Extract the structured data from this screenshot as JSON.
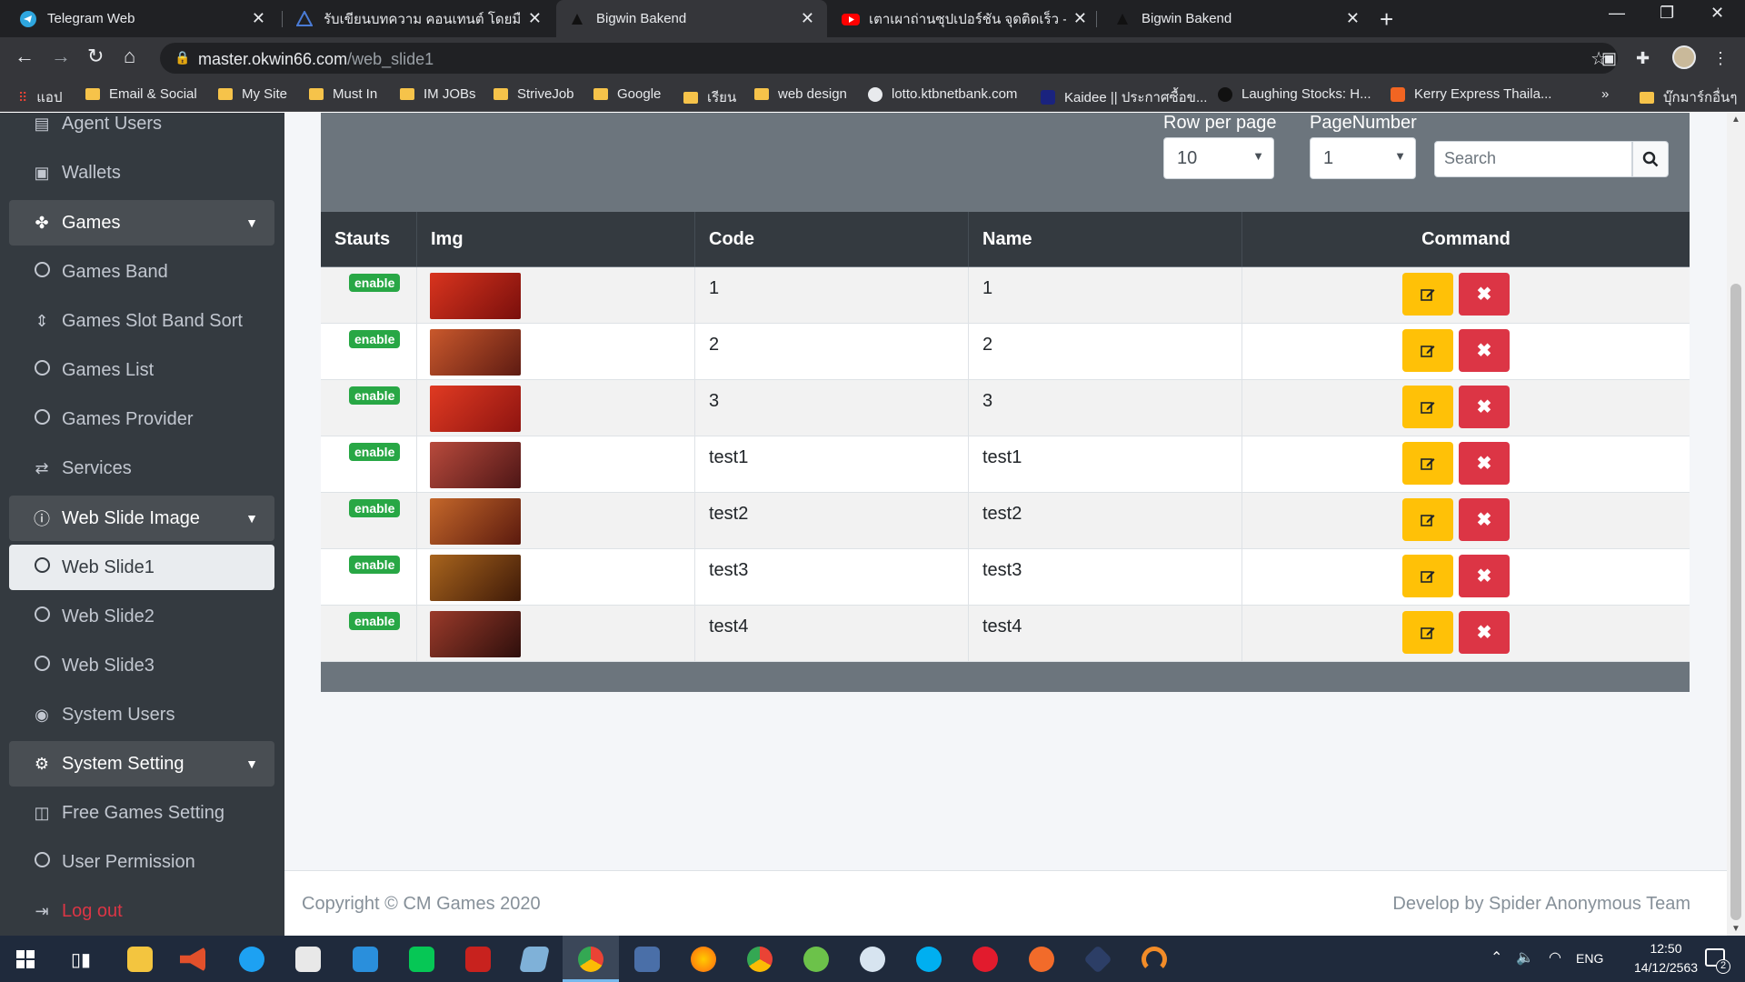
{
  "browser": {
    "tabs": [
      {
        "title": "Telegram Web",
        "active": false
      },
      {
        "title": "รับเขียนบทความ คอนเทนต์ โดยมืออาชีพ",
        "active": false
      },
      {
        "title": "Bigwin Bakend",
        "active": true
      },
      {
        "title": "เตาเผาถ่านซุปเปอร์ชัน จุดติดเร็ว - YouTube",
        "active": false
      },
      {
        "title": "Bigwin Bakend",
        "active": false
      }
    ],
    "new_tab_icon": "+",
    "url_domain": "master.okwin66.com",
    "url_path": "/web_slide1",
    "bookmarks": [
      "แอป",
      "Email & Social",
      "My Site",
      "Must In",
      "IM JOBs",
      "StriveJob",
      "Google",
      "เรียน",
      "web design",
      "lotto.ktbnetbank.com",
      "Kaidee || ประกาศซื้อข...",
      "Laughing Stocks: H...",
      "Kerry Express Thaila...",
      "»",
      "บุ๊กมาร์กอื่นๆ"
    ]
  },
  "sidebar": {
    "items": [
      {
        "label": "Agent Users",
        "icon": "address-card-icon",
        "type": "item"
      },
      {
        "label": "Wallets",
        "icon": "money-icon",
        "type": "item"
      },
      {
        "label": "Games",
        "icon": "gamepad-icon",
        "type": "group"
      },
      {
        "label": "Games Band",
        "icon": "circle-icon",
        "type": "item"
      },
      {
        "label": "Games Slot Band Sort",
        "icon": "sort-icon",
        "type": "item"
      },
      {
        "label": "Games List",
        "icon": "circle-icon",
        "type": "item"
      },
      {
        "label": "Games Provider",
        "icon": "circle-icon",
        "type": "item"
      },
      {
        "label": "Services",
        "icon": "exchange-icon",
        "type": "item"
      },
      {
        "label": "Web Slide Image",
        "icon": "info-circle-icon",
        "type": "group"
      },
      {
        "label": "Web Slide1",
        "icon": "circle-icon",
        "type": "active"
      },
      {
        "label": "Web Slide2",
        "icon": "circle-icon",
        "type": "item"
      },
      {
        "label": "Web Slide3",
        "icon": "circle-icon",
        "type": "item"
      },
      {
        "label": "System Users",
        "icon": "user-circle-icon",
        "type": "item"
      },
      {
        "label": "System Setting",
        "icon": "cogs-icon",
        "type": "group"
      },
      {
        "label": "Free Games Setting",
        "icon": "gamepad-icon",
        "type": "item"
      },
      {
        "label": "User Permission",
        "icon": "circle-icon",
        "type": "item"
      },
      {
        "label": "Log out",
        "icon": "sign-out-icon",
        "type": "logout"
      }
    ]
  },
  "controls": {
    "row_per_page_label": "Row per page",
    "row_per_page_value": "10",
    "page_number_label": "PageNumber",
    "page_number_value": "1",
    "search_placeholder": "Search"
  },
  "table": {
    "headers": [
      "Stauts",
      "Img",
      "Code",
      "Name",
      "Command"
    ],
    "rows": [
      {
        "status": "enable",
        "code": "1",
        "name": "1",
        "thumb_color": "#b0201a"
      },
      {
        "status": "enable",
        "code": "2",
        "name": "2",
        "thumb_color": "#a33a22"
      },
      {
        "status": "enable",
        "code": "3",
        "name": "3",
        "thumb_color": "#c0231c"
      },
      {
        "status": "enable",
        "code": "test1",
        "name": "test1",
        "thumb_color": "#8f2c2a"
      },
      {
        "status": "enable",
        "code": "test2",
        "name": "test2",
        "thumb_color": "#a54a24"
      },
      {
        "status": "enable",
        "code": "test3",
        "name": "test3",
        "thumb_color": "#8a3d15"
      },
      {
        "status": "enable",
        "code": "test4",
        "name": "test4",
        "thumb_color": "#6d2220"
      }
    ]
  },
  "footer": {
    "copyright": "Copyright © CM Games 2020",
    "developer": "Develop by Spider Anonymous Team"
  },
  "taskbar": {
    "language": "ENG",
    "time": "12:50",
    "date": "14/12/2563",
    "notifications": "2"
  },
  "colors": {
    "sidebar_bg": "#343a40",
    "panel_bg": "#6c757d",
    "badge_green": "#28a745",
    "edit_yellow": "#ffc107",
    "delete_red": "#dc3545"
  }
}
